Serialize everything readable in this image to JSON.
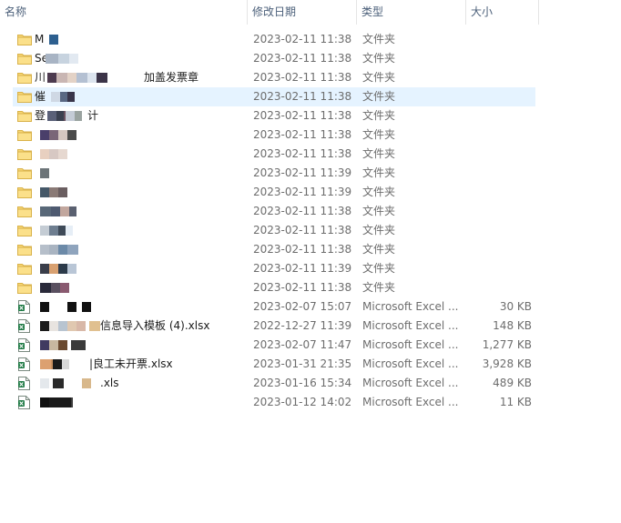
{
  "header": {
    "columns": [
      {
        "key": "name",
        "label": "名称"
      },
      {
        "key": "date",
        "label": "修改日期"
      },
      {
        "key": "type",
        "label": "类型"
      },
      {
        "key": "size",
        "label": "大小"
      }
    ],
    "sort_indicator": "^"
  },
  "rows": [
    {
      "kind": "folder",
      "name_prefix": "M",
      "name_suffix": "",
      "date": "2023-02-11 11:38",
      "type": "文件夹",
      "size": "",
      "selected": false
    },
    {
      "kind": "folder",
      "name_prefix": "Se",
      "name_suffix": "",
      "date": "2023-02-11 11:38",
      "type": "文件夹",
      "size": "",
      "selected": false
    },
    {
      "kind": "folder",
      "name_prefix": "川",
      "name_suffix": "加盖发票章",
      "date": "2023-02-11 11:38",
      "type": "文件夹",
      "size": "",
      "selected": false
    },
    {
      "kind": "folder",
      "name_prefix": "催",
      "name_suffix": "",
      "date": "2023-02-11 11:38",
      "type": "文件夹",
      "size": "",
      "selected": true
    },
    {
      "kind": "folder",
      "name_prefix": "登",
      "name_suffix": "计",
      "date": "2023-02-11 11:38",
      "type": "文件夹",
      "size": "",
      "selected": false
    },
    {
      "kind": "folder",
      "name_prefix": "",
      "name_suffix": "",
      "date": "2023-02-11 11:38",
      "type": "文件夹",
      "size": "",
      "selected": false
    },
    {
      "kind": "folder",
      "name_prefix": "",
      "name_suffix": "",
      "date": "2023-02-11 11:38",
      "type": "文件夹",
      "size": "",
      "selected": false
    },
    {
      "kind": "folder",
      "name_prefix": "",
      "name_suffix": "",
      "date": "2023-02-11 11:39",
      "type": "文件夹",
      "size": "",
      "selected": false
    },
    {
      "kind": "folder",
      "name_prefix": "",
      "name_suffix": "",
      "date": "2023-02-11 11:39",
      "type": "文件夹",
      "size": "",
      "selected": false
    },
    {
      "kind": "folder",
      "name_prefix": "",
      "name_suffix": "",
      "date": "2023-02-11 11:38",
      "type": "文件夹",
      "size": "",
      "selected": false
    },
    {
      "kind": "folder",
      "name_prefix": "",
      "name_suffix": "",
      "date": "2023-02-11 11:38",
      "type": "文件夹",
      "size": "",
      "selected": false
    },
    {
      "kind": "folder",
      "name_prefix": "",
      "name_suffix": "",
      "date": "2023-02-11 11:38",
      "type": "文件夹",
      "size": "",
      "selected": false
    },
    {
      "kind": "folder",
      "name_prefix": "",
      "name_suffix": "",
      "date": "2023-02-11 11:39",
      "type": "文件夹",
      "size": "",
      "selected": false
    },
    {
      "kind": "folder",
      "name_prefix": "",
      "name_suffix": "",
      "date": "2023-02-11 11:38",
      "type": "文件夹",
      "size": "",
      "selected": false
    },
    {
      "kind": "excel",
      "name_prefix": "",
      "name_suffix": "",
      "date": "2023-02-07 15:07",
      "type": "Microsoft Excel ...",
      "size": "30 KB",
      "selected": false
    },
    {
      "kind": "excel",
      "name_prefix": "",
      "name_suffix": "信息导入模板 (4).xlsx",
      "date": "2022-12-27 11:39",
      "type": "Microsoft Excel ...",
      "size": "148 KB",
      "selected": false
    },
    {
      "kind": "excel",
      "name_prefix": "",
      "name_suffix": "",
      "date": "2023-02-07 11:47",
      "type": "Microsoft Excel ...",
      "size": "1,277 KB",
      "selected": false
    },
    {
      "kind": "excel",
      "name_prefix": "",
      "name_suffix": "|良工未开票.xlsx",
      "date": "2023-01-31 21:35",
      "type": "Microsoft Excel ...",
      "size": "3,928 KB",
      "selected": false
    },
    {
      "kind": "excel",
      "name_prefix": "",
      "name_suffix": ".xls",
      "date": "2023-01-16 15:34",
      "type": "Microsoft Excel ...",
      "size": "489 KB",
      "selected": false
    },
    {
      "kind": "excel",
      "name_prefix": "",
      "name_suffix": "",
      "date": "2023-01-12 14:02",
      "type": "Microsoft Excel ...",
      "size": "11 KB",
      "selected": false
    }
  ],
  "colors": {
    "header_text": "#4c607a",
    "selection": "#e5f3ff",
    "folder": "#f8d775",
    "excel": "#1f7a45"
  },
  "icons": {
    "folder": "folder-icon",
    "excel": "excel-file-icon"
  }
}
